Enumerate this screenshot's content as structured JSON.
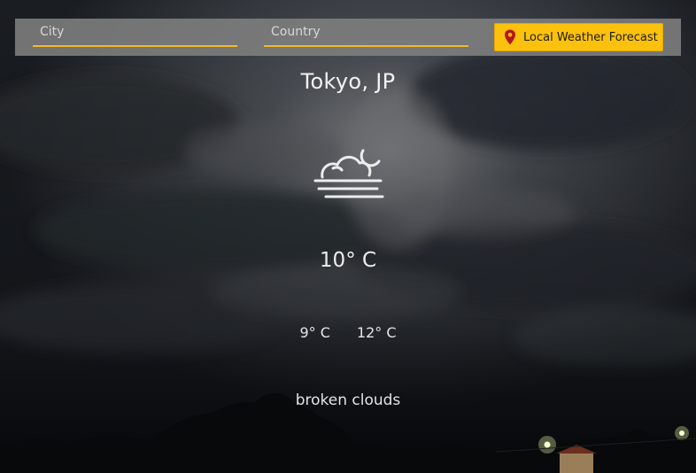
{
  "search": {
    "city_placeholder": "City",
    "country_placeholder": "Country",
    "city_value": "",
    "country_value": ""
  },
  "forecast_button": {
    "label": "Local Weather Forecast",
    "icon": "map-pin-icon"
  },
  "weather": {
    "location": "Tokyo, JP",
    "icon": "fog-cloud-moon-icon",
    "temperature": "10° C",
    "temp_min": "9° C",
    "temp_max": "12° C",
    "description": "broken clouds"
  },
  "colors": {
    "accent": "#fcc10c",
    "underline": "#f1b82c",
    "topbar": "#808080",
    "pin": "#b3161b"
  }
}
